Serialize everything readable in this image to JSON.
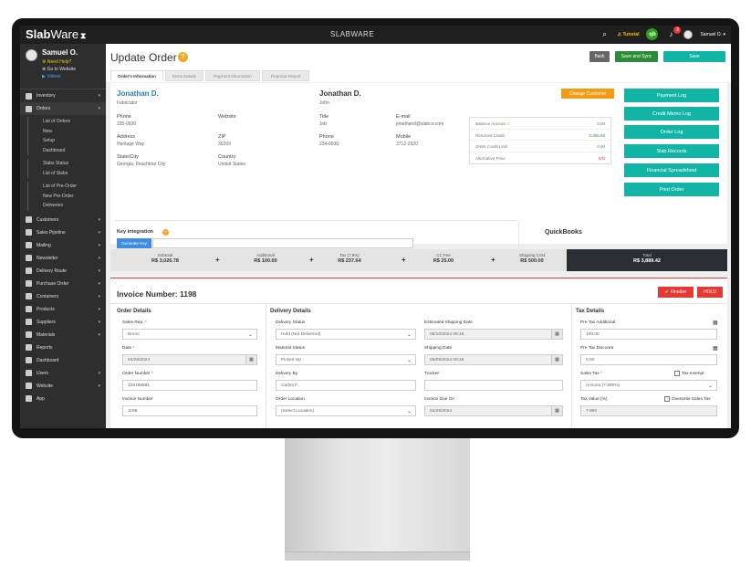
{
  "topbar": {
    "brand_main": "Slab",
    "brand_sub": "Ware",
    "title": "SLABWARE",
    "tutorial": "Tutorial",
    "qb": "qb",
    "notif_count": "3",
    "user": "Samuel O."
  },
  "sidebar": {
    "profile": {
      "name": "Samuel O.",
      "help": "Need Help?",
      "website": "Go to Website",
      "videos": "Videos"
    },
    "items": [
      {
        "label": "Inventory"
      },
      {
        "label": "Orders"
      },
      {
        "label": "Customers"
      },
      {
        "label": "Sales Pipeline"
      },
      {
        "label": "Mailing"
      },
      {
        "label": "Newsletter"
      },
      {
        "label": "Delivery Route"
      },
      {
        "label": "Purchase Order"
      },
      {
        "label": "Containers"
      },
      {
        "label": "Products"
      },
      {
        "label": "Suppliers"
      },
      {
        "label": "Materials"
      },
      {
        "label": "Reports"
      },
      {
        "label": "Dashboard"
      },
      {
        "label": "Users"
      },
      {
        "label": "Website"
      },
      {
        "label": "App"
      }
    ],
    "orders_sub": [
      "List of Orders",
      "New",
      "Setup",
      "Dashboard",
      "Slabs Status",
      "List of Slabs",
      "List of Pre-Order",
      "New Pre-Order",
      "Deliveries"
    ]
  },
  "header": {
    "title": "Update Order",
    "help": "?",
    "back": "Back",
    "save_sync": "Save and Sync",
    "save": "Save"
  },
  "tabs": [
    "Order's Information",
    "Items Details",
    "Payment Information",
    "Financial Report"
  ],
  "customer": {
    "name": "Jonathan D.",
    "role": "Fabricator",
    "phone_label": "Phone",
    "phone": "235-0930",
    "website_label": "Website",
    "website": "",
    "address_label": "Address",
    "address": "Heritage Way",
    "zip_label": "ZIP",
    "zip": "30269",
    "state_label": "State/City",
    "state": "Georgia, Peachtree City",
    "country_label": "Country",
    "country": "United States"
  },
  "contact": {
    "name": "Jonathan D.",
    "sub": "John",
    "title_label": "Title",
    "title": "Job",
    "email_label": "E-mail",
    "email": "jonathand@slabco.com",
    "phone_label": "Phone",
    "phone": "234-0930",
    "mobile_label": "Mobile",
    "mobile": "3712-2920"
  },
  "change_customer": "Change Customer",
  "balance": [
    {
      "label": "Balance Amount",
      "value": "0.00"
    },
    {
      "label": "Returned Credit",
      "value": "3,306.93"
    },
    {
      "label": "Order Credit Limit",
      "value": "0.00"
    },
    {
      "label": "Alternative Price",
      "value": "S/N"
    }
  ],
  "side_buttons": [
    "Payment Log",
    "Credit Memo Log",
    "Order Log",
    "Slab Records",
    "Financial Spreadsheet",
    "Print Order"
  ],
  "key": {
    "label": "Key integration",
    "help": "?",
    "button": "Generate Key",
    "value": ""
  },
  "quickbooks": "QuickBooks",
  "totals": {
    "subtotal": {
      "label": "Subtotal",
      "value": "R$ 3,026.78"
    },
    "additional": {
      "label": "Additional",
      "value": "R$ 100.00"
    },
    "tax": {
      "label": "Tax (7.8%)",
      "value": "R$ 237.64"
    },
    "ccfee": {
      "label": "CC Fee",
      "value": "R$ 25.00"
    },
    "shipping": {
      "label": "Shipping Cost",
      "value": "R$ 500.00"
    },
    "total": {
      "label": "Total",
      "value": "R$ 3,889.42"
    },
    "plus": "+"
  },
  "invoice": {
    "title": "Invoice Number: 1198",
    "finalize": "Finalize",
    "hold": "HOLD",
    "order_details": {
      "title": "Order Details",
      "sales_rep_label": "Sales Rep.",
      "sales_rep": "Bruno",
      "date_label": "Date",
      "date": "04/29/2024",
      "order_number_label": "Order Number",
      "order_number": "429189581",
      "invoice_number_label": "Invoice Number",
      "invoice_number": "1198"
    },
    "delivery_details": {
      "title": "Delivery Details",
      "status_label": "Delivery Status",
      "status": "Hold (Not Delivered)",
      "est_ship_label": "Estimated Shipping Date",
      "est_ship": "05/10/2024 09:16",
      "material_label": "Material Status",
      "material": "Picked Up",
      "ship_date_label": "Shipping Date",
      "ship_date": "05/09/2024 09:16",
      "delivery_by_label": "Delivery By",
      "delivery_by": "Carlos F.",
      "trucker_label": "Trucker",
      "trucker": "",
      "location_label": "Order Location",
      "location": "(Select Location)",
      "due_label": "Invoice Due On",
      "due": "04/29/2024"
    },
    "tax_details": {
      "title": "Tax Details",
      "pre_add_label": "Pre Tax Additional",
      "pre_add": "100.00",
      "pre_disc_label": "Pre Tax Discount",
      "pre_disc": "0.00",
      "sales_tax_label": "Sales Tax",
      "sales_tax": "Arizona (7.800%)",
      "tax_exempt": "Tax exempt",
      "tax_value_label": "Tax Value (%)",
      "tax_value": "7.800",
      "overwrite": "Overwrite Sales Tax"
    }
  }
}
